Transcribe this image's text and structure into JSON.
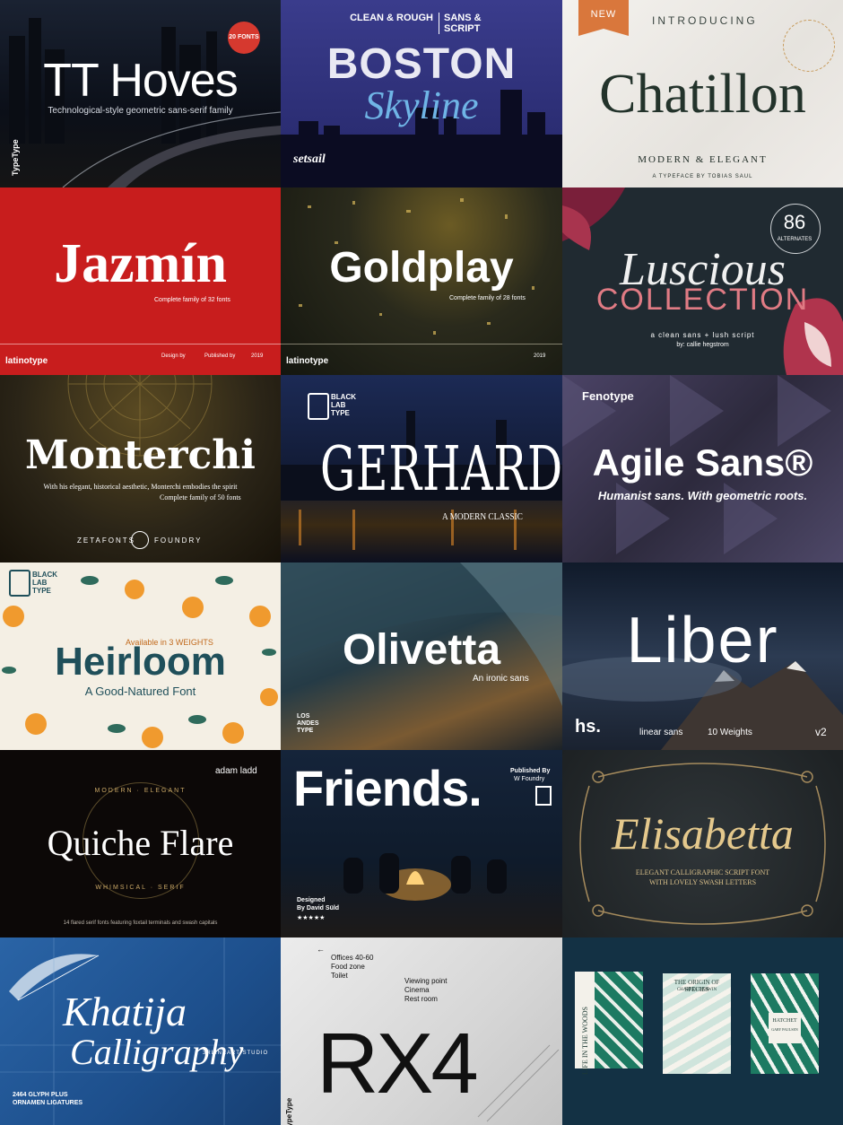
{
  "tiles": {
    "tt_hoves": {
      "title": "TT Hoves",
      "subtitle": "Technological-style geometric sans-serif family",
      "badge": "20 FONTS",
      "brand": "TypeType",
      "bg": "#0e121b"
    },
    "boston": {
      "tag_left": "CLEAN & ROUGH",
      "tag_right": "SANS & SCRIPT",
      "title": "BOSTON",
      "script": "Skyline",
      "brand": "setsail",
      "bg": "#2b2d73"
    },
    "chatillon": {
      "ribbon": "NEW",
      "kicker": "INTRODUCING",
      "title": "Chatillon",
      "tagline": "MODERN & ELEGANT",
      "byline": "A TYPEFACE BY TOBIAS SAUL",
      "bg": "#eeece8"
    },
    "jazmin": {
      "title": "Jazmín",
      "subtitle": "Complete family of 32 fonts",
      "brand": "latinotype",
      "credit_design": "Design by",
      "credit_published": "Published by",
      "year": "2019",
      "bg": "#c81d1d"
    },
    "goldplay": {
      "title": "Goldplay",
      "subtitle": "Complete family of 28 fonts",
      "brand": "latinotype",
      "year": "2019",
      "bg": "#1b1d15"
    },
    "luscious": {
      "count": "86",
      "count_label": "ALTERNATES",
      "script": "Luscious",
      "title": "COLLECTION",
      "tagline": "a clean sans + lush script",
      "byline": "by: callie hegstrom",
      "bg": "#202a31"
    },
    "monterchi": {
      "title": "Monterchi",
      "subtitle_1": "With his elegant, historical aesthetic, Monterchi embodies the spirit",
      "subtitle_2": "Complete family of 50 fonts",
      "foundry_left": "ZETAFONTS",
      "foundry_right": "FOUNDRY",
      "bg": "#2a2417"
    },
    "gerhard": {
      "brand_1": "BLACK",
      "brand_2": "LAB",
      "brand_3": "TYPE",
      "title": "GERHARD",
      "subtitle": "A MODERN CLASSIC",
      "bg": "#111a33"
    },
    "agile": {
      "brand": "Fenotype",
      "title": "Agile Sans®",
      "subtitle": "Humanist sans. With geometric roots.",
      "bg": "#3a3550"
    },
    "heirloom": {
      "brand_1": "BLACK",
      "brand_2": "LAB",
      "brand_3": "TYPE",
      "available": "Available in 3 WEIGHTS",
      "title": "Heirloom",
      "subtitle": "A Good-Natured Font",
      "bg": "#f4efe4",
      "accent": "#1f4f5a"
    },
    "olivetta": {
      "title": "Olivetta",
      "subtitle": "An ironic sans",
      "brand_1": "LOS",
      "brand_2": "ANDES",
      "brand_3": "TYPE",
      "bg": "#253b46"
    },
    "liber": {
      "title": "Liber",
      "brand": "hs.",
      "caption_1": "linear sans",
      "caption_2": "10 Weights",
      "version": "v2",
      "bg": "#1b2738"
    },
    "quiche": {
      "brand": "adam ladd",
      "ring_top": "MODERN · ELEGANT",
      "ring_bottom": "WHIMSICAL · SERIF",
      "title": "Quiche Flare",
      "footnote": "14 flared serif fonts featuring foxtail terminals and swash capitals",
      "bg": "#0c0807"
    },
    "friends": {
      "title": "Friends.",
      "publisher_1": "Published By",
      "publisher_2": "W Foundry",
      "designer_1": "Designed",
      "designer_2": "By David Süld",
      "stars": "★★★★★",
      "bg": "#0f1b2b"
    },
    "elisabetta": {
      "title": "Elisabetta",
      "subtitle_1": "ELEGANT CALLIGRAPHIC SCRIPT FONT",
      "subtitle_2": "WITH LOVELY SWASH LETTERS",
      "bg": "#23282b"
    },
    "khatija": {
      "title_1": "Khatija",
      "title_2": "Calligraphy",
      "note_1": "2464 GLYPH PLUS",
      "note_2": "ORNAMEN LIGATURES",
      "studio": "3RLINEART STUDIO",
      "bg": "#1d4f8c"
    },
    "rx4": {
      "sign_1": "Offices 40-60",
      "sign_2": "Food zone",
      "sign_3": "Toilet",
      "sign_4": "Viewing point",
      "sign_5": "Cinema",
      "sign_6": "Rest room",
      "title": "RX4",
      "brand": "TypeType",
      "bg": "#dcdcdc"
    },
    "books": {
      "book_1": "LIFE IN THE WOODS",
      "book_2": "THE ORIGIN OF SPECIES",
      "book_2_author": "CHARLES DARWIN",
      "book_3": "HATCHET",
      "book_3_author": "GARY PAULSEN",
      "bg": "#133144",
      "accent": "#1d7a62"
    }
  }
}
